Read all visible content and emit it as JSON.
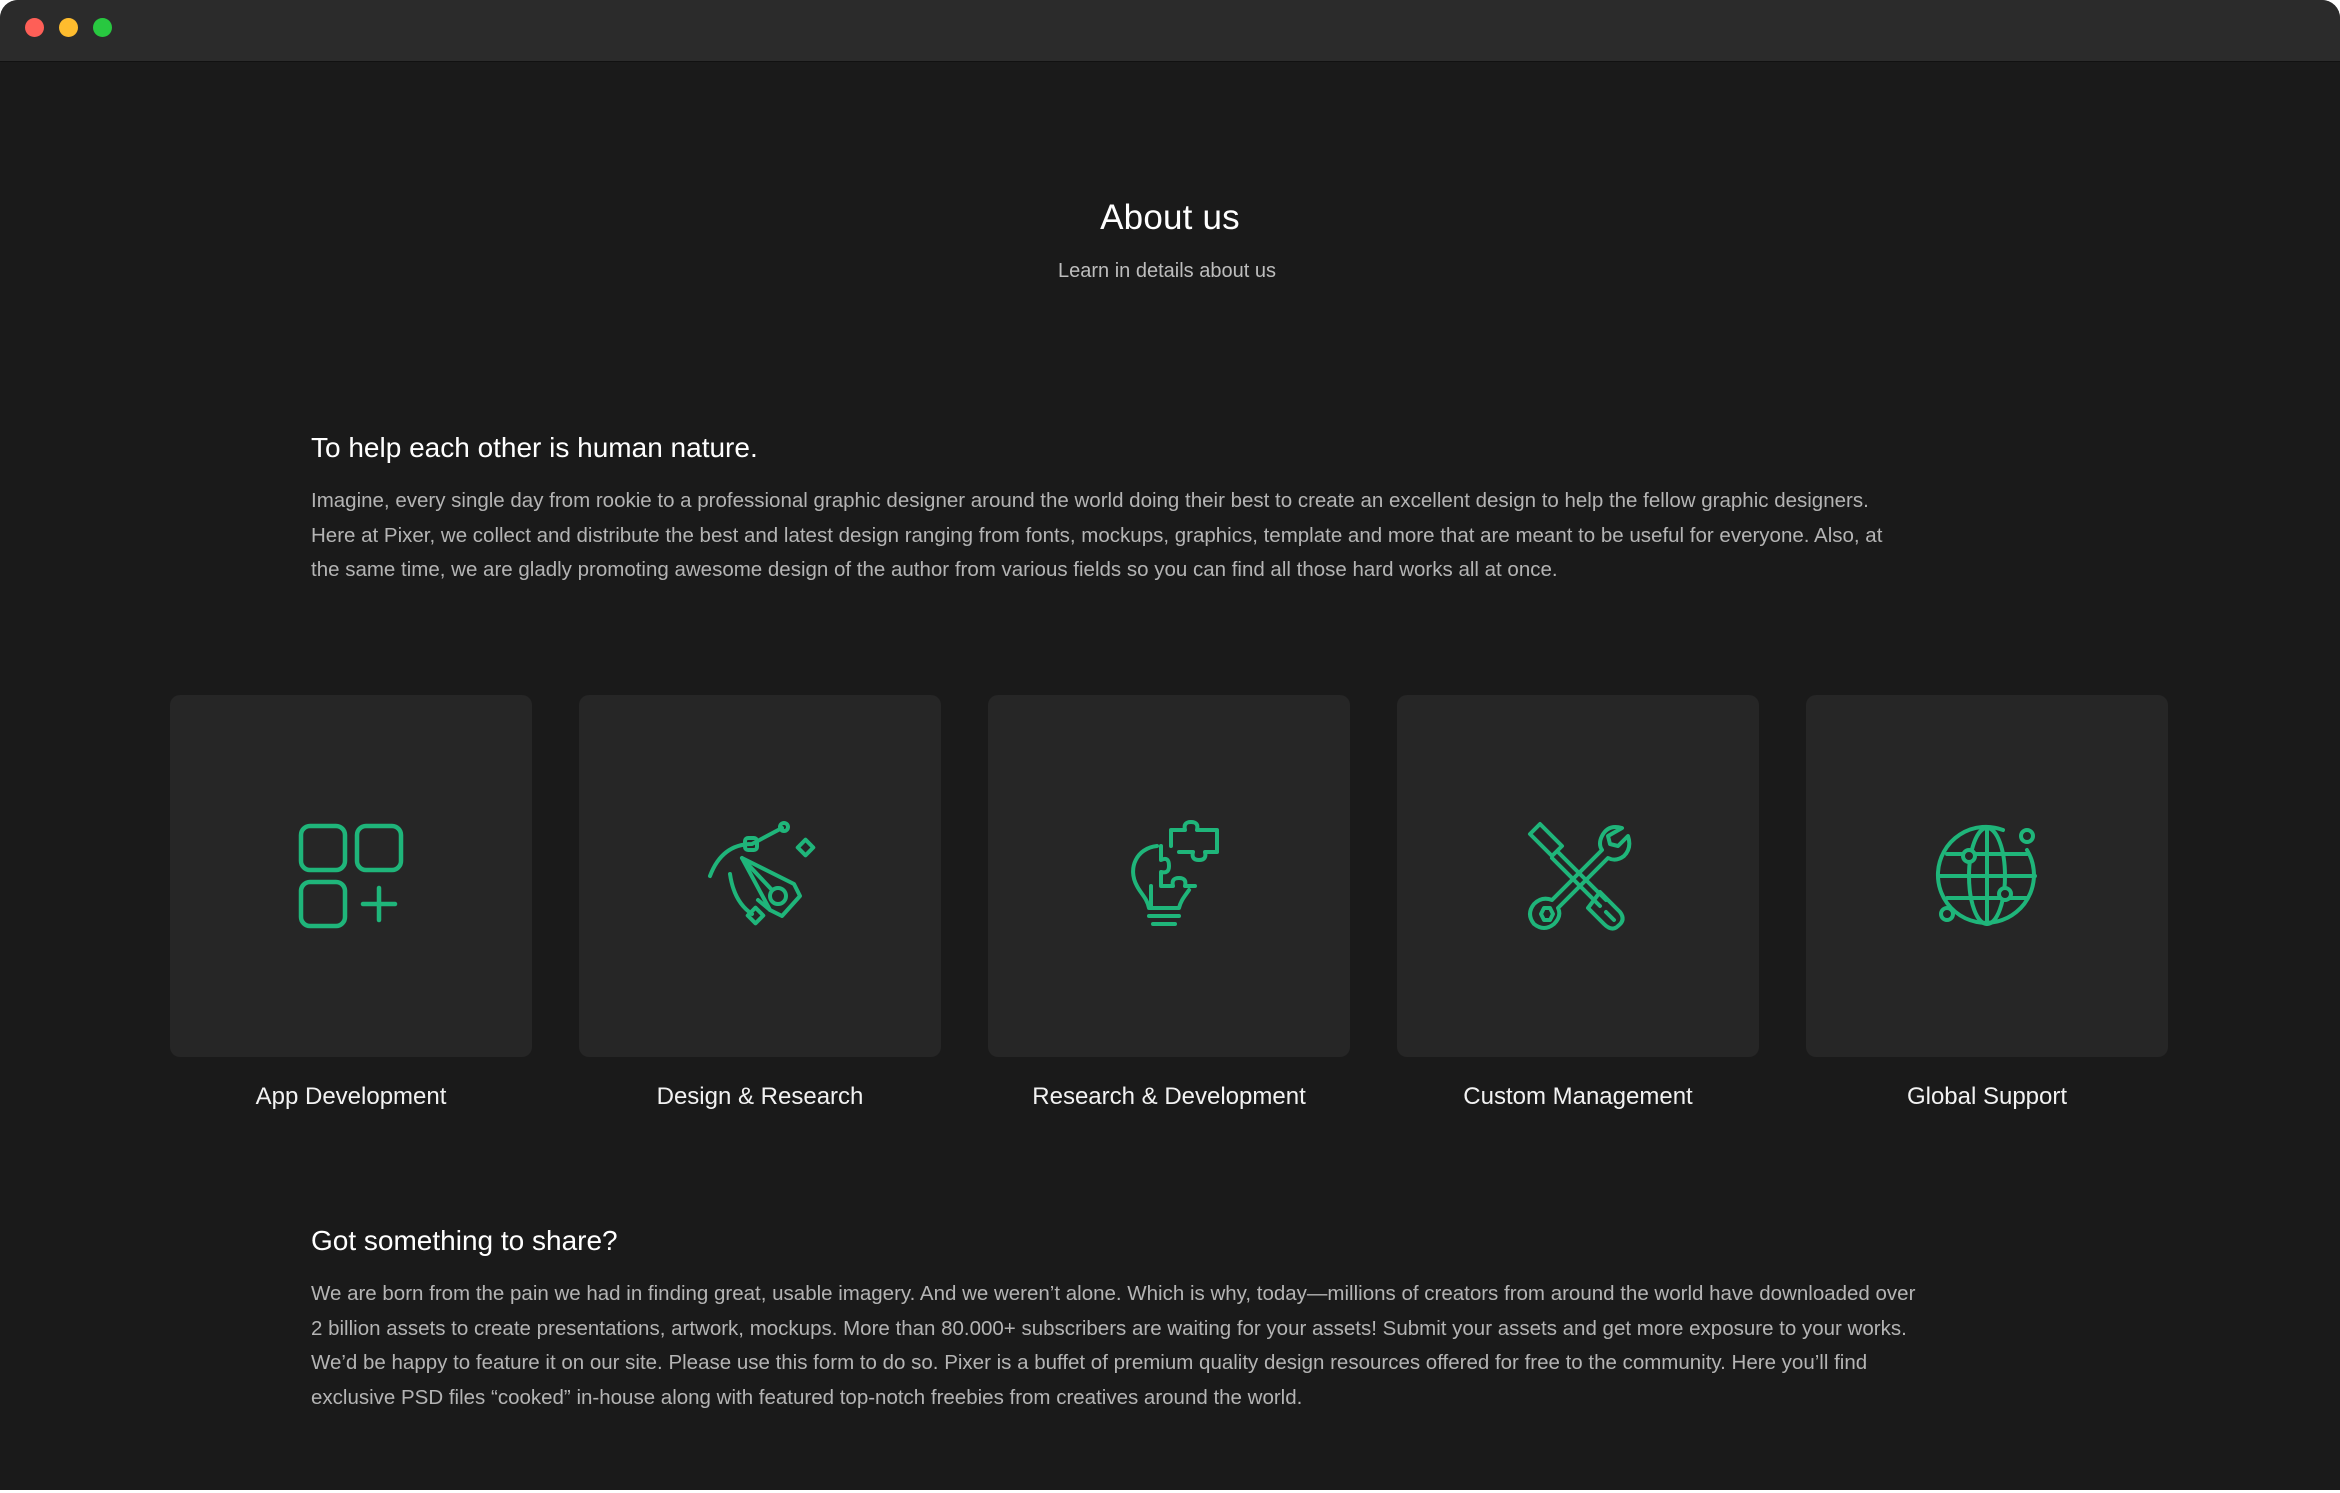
{
  "window": {
    "controls": [
      "close",
      "minimize",
      "maximize"
    ]
  },
  "hero": {
    "title": "About us",
    "subtitle": "Learn in details about us"
  },
  "section_intro": {
    "title": "To help each other is human nature.",
    "body_lines": [
      "Imagine, every single day from rookie to a professional graphic designer around the world doing their best to create an excellent design to help the fellow graphic designers.",
      "Here at Pixer, we collect and distribute the best and latest design ranging from fonts, mockups, graphics, template and more that are meant to be useful for everyone. Also, at",
      "the same time, we are gladly promoting awesome design of the author from various fields so you can find all those hard works all at once."
    ]
  },
  "services": [
    {
      "label": "App Development",
      "icon": "app-grid-plus-icon"
    },
    {
      "label": "Design & Research",
      "icon": "pen-tool-icon"
    },
    {
      "label": "Research & Development",
      "icon": "lightbulb-puzzle-icon"
    },
    {
      "label": "Custom Management",
      "icon": "wrench-screwdriver-icon"
    },
    {
      "label": "Global Support",
      "icon": "globe-network-icon"
    }
  ],
  "section_share": {
    "title": "Got something to share?",
    "body_lines": [
      "We are born from the pain we had in finding great, usable imagery. And we weren’t alone. Which is why, today—millions of creators from around the world have downloaded over",
      "2 billion assets to create presentations, artwork, mockups. More than 80.000+ subscribers are waiting for your assets! Submit your assets and get more exposure to your works.",
      "We’d be happy to feature it on our site. Please use this form to do so. Pixer is a buffet of premium quality design resources offered for free to the community. Here you’ll find",
      "exclusive PSD files “cooked” in-house along with featured top-notch freebies from creatives around the world."
    ]
  },
  "colors": {
    "background": "#1a1a1a",
    "titlebar": "#2b2b2b",
    "card": "#262626",
    "accent": "#1fb57a",
    "heading": "#ffffff",
    "body_text": "#b4b4b4"
  }
}
